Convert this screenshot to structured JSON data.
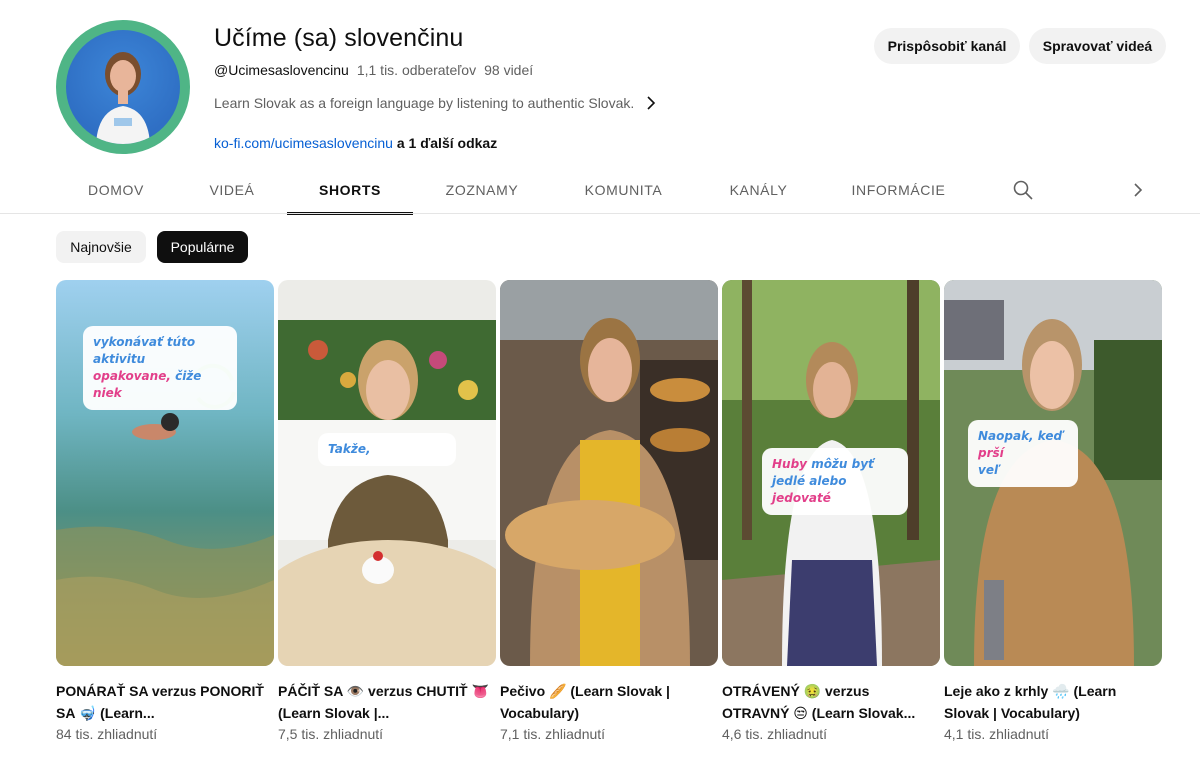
{
  "channel": {
    "title": "Učíme (sa) slovenčinu",
    "handle": "@Ucimesaslovencinu",
    "subscribers": "1,1 tis. odberateľov",
    "videos": "98 videí",
    "description": "Learn Slovak as a foreign language by listening to authentic Slovak.",
    "link": "ko-fi.com/ucimesaslovencinu",
    "more_links": "a 1 ďalší odkaz"
  },
  "buttons": {
    "customize": "Prispôsobiť kanál",
    "manage": "Spravovať videá"
  },
  "tabs": [
    {
      "label": "DOMOV"
    },
    {
      "label": "VIDEÁ"
    },
    {
      "label": "SHORTS",
      "active": true
    },
    {
      "label": "ZOZNAMY"
    },
    {
      "label": "KOMUNITA"
    },
    {
      "label": "KANÁLY"
    },
    {
      "label": "INFORMÁCIE"
    }
  ],
  "icons": {
    "search": "search-icon",
    "tabs_next": "chevron-right-icon",
    "description_more": "chevron-right-icon"
  },
  "chips": {
    "newest": "Najnovšie",
    "popular": "Populárne",
    "selected": "Populárne"
  },
  "shorts": [
    {
      "title": "PONÁRAŤ SA verzus PONORIŤ SA 🤿 (Learn...",
      "views": "84 tis. zhliadnutí",
      "overlay": {
        "line1": "vykonávať túto aktivitu",
        "line2": "opakovane,",
        "line2b": "čiže",
        "line3": "niek"
      }
    },
    {
      "title": "PÁČIŤ SA 👁️ verzus CHUTIŤ 👅 (Learn Slovak |...",
      "views": "7,5 tis. zhliadnutí",
      "overlay": {
        "line1": "Takže,"
      }
    },
    {
      "title": "Pečivo 🥖 (Learn Slovak | Vocabulary)",
      "views": "7,1 tis. zhliadnutí"
    },
    {
      "title": "OTRÁVENÝ 🤢 verzus OTRAVNÝ 😒 (Learn Slovak...",
      "views": "4,6 tis. zhliadnutí",
      "overlay": {
        "line1a": "Huby",
        "line1b": "môžu byť",
        "line2": "jedlé alebo",
        "line3": "jedovaté"
      }
    },
    {
      "title": "Leje ako z krhly 🌧️ (Learn Slovak | Vocabulary)",
      "views": "4,1 tis. zhliadnutí",
      "overlay": {
        "line1a": "Naopak, keď",
        "line1b": "prší",
        "line2": "veľ"
      }
    }
  ],
  "colors": {
    "link": "#065fd4",
    "avatar_ring": "#4fb586",
    "chip_selected": "#0f0f0f",
    "overlay_blue": "#3f8bdc",
    "overlay_pink": "#e23f8a"
  }
}
